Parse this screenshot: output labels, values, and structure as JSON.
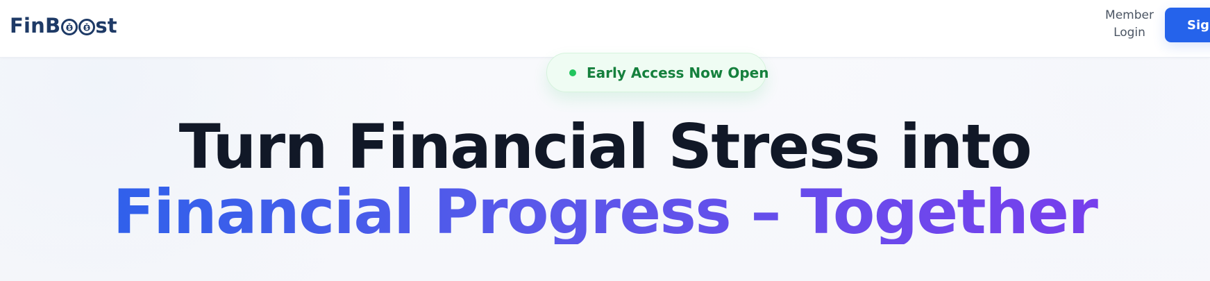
{
  "header": {
    "logo": {
      "prefix": "FinB",
      "suffix": "st"
    },
    "member_login": "Member\nLogin",
    "signup_button": "Sign"
  },
  "hero": {
    "badge": "Early Access Now Open",
    "headline_line1": "Turn Financial Stress into",
    "headline_line2": "Financial Progress – Together"
  },
  "colors": {
    "primary_blue": "#2563eb",
    "purple": "#7c3aed",
    "dark_text": "#111827",
    "navy_logo": "#1e3a66",
    "green_badge_text": "#15803d",
    "green_dot": "#22c55e"
  },
  "icons": {
    "logo_mark": "money-bag-icon",
    "status_dot": "status-dot-icon"
  }
}
